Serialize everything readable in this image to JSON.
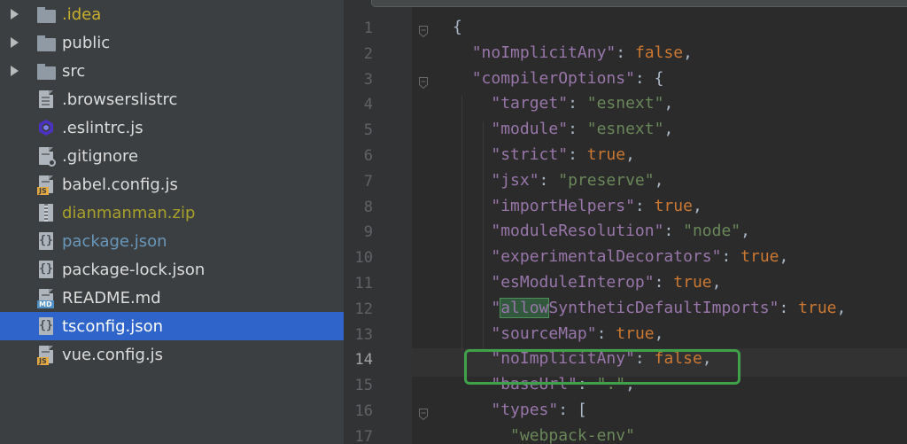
{
  "sidebar": {
    "items": [
      {
        "label": "idea",
        "prefix": ".",
        "icon": "folder-icon",
        "expandable": true,
        "color": "#c9b12d"
      },
      {
        "label": "public",
        "prefix": "",
        "icon": "folder-icon",
        "expandable": true,
        "color": "#dcdcdc"
      },
      {
        "label": "src",
        "prefix": "",
        "icon": "folder-icon",
        "expandable": true,
        "color": "#dcdcdc"
      },
      {
        "label": ".browserslistrc",
        "icon": "text-file-icon",
        "color": "#dcdcdc"
      },
      {
        "label": ".eslintrc.js",
        "icon": "eslint-icon",
        "color": "#dcdcdc"
      },
      {
        "label": ".gitignore",
        "icon": "gitignore-file-icon",
        "color": "#dcdcdc"
      },
      {
        "label": "babel.config.js",
        "icon": "js-file-icon",
        "color": "#dcdcdc"
      },
      {
        "label": "dianmanman.zip",
        "icon": "zip-file-icon",
        "color": "#a8a02a"
      },
      {
        "label": "package.json",
        "icon": "json-file-icon",
        "color": "#6897bb"
      },
      {
        "label": "package-lock.json",
        "icon": "json-file-icon",
        "color": "#dcdcdc"
      },
      {
        "label": "README.md",
        "icon": "md-file-icon",
        "color": "#dcdcdc"
      },
      {
        "label": "tsconfig.json",
        "icon": "json-file-icon",
        "color": "#ffffff",
        "selected": true
      },
      {
        "label": "vue.config.js",
        "icon": "js-file-icon",
        "color": "#dcdcdc"
      }
    ],
    "badges": {
      "js": "JS",
      "md": "MD"
    }
  },
  "editor": {
    "current_line": 14,
    "lines": [
      {
        "n": "1",
        "parts": [
          [
            "p",
            "{"
          ]
        ]
      },
      {
        "n": "2",
        "parts": [
          [
            "p",
            "  "
          ],
          [
            "k",
            "\"noImplicitAny\""
          ],
          [
            "p",
            ": "
          ],
          [
            "b",
            "false"
          ],
          [
            "p",
            ","
          ]
        ]
      },
      {
        "n": "3",
        "parts": [
          [
            "p",
            "  "
          ],
          [
            "k",
            "\"compilerOptions\""
          ],
          [
            "p",
            ": {"
          ]
        ]
      },
      {
        "n": "4",
        "parts": [
          [
            "p",
            "    "
          ],
          [
            "k",
            "\"target\""
          ],
          [
            "p",
            ": "
          ],
          [
            "s",
            "\"esnext\""
          ],
          [
            "p",
            ","
          ]
        ]
      },
      {
        "n": "5",
        "parts": [
          [
            "p",
            "    "
          ],
          [
            "k",
            "\"module\""
          ],
          [
            "p",
            ": "
          ],
          [
            "s",
            "\"esnext\""
          ],
          [
            "p",
            ","
          ]
        ]
      },
      {
        "n": "6",
        "parts": [
          [
            "p",
            "    "
          ],
          [
            "k",
            "\"strict\""
          ],
          [
            "p",
            ": "
          ],
          [
            "b",
            "true"
          ],
          [
            "p",
            ","
          ]
        ]
      },
      {
        "n": "7",
        "parts": [
          [
            "p",
            "    "
          ],
          [
            "k",
            "\"jsx\""
          ],
          [
            "p",
            ": "
          ],
          [
            "s",
            "\"preserve\""
          ],
          [
            "p",
            ","
          ]
        ]
      },
      {
        "n": "8",
        "parts": [
          [
            "p",
            "    "
          ],
          [
            "k",
            "\"importHelpers\""
          ],
          [
            "p",
            ": "
          ],
          [
            "b",
            "true"
          ],
          [
            "p",
            ","
          ]
        ]
      },
      {
        "n": "9",
        "parts": [
          [
            "p",
            "    "
          ],
          [
            "k",
            "\"moduleResolution\""
          ],
          [
            "p",
            ": "
          ],
          [
            "s",
            "\"node\""
          ],
          [
            "p",
            ","
          ]
        ]
      },
      {
        "n": "10",
        "parts": [
          [
            "p",
            "    "
          ],
          [
            "k",
            "\"experimentalDecorators\""
          ],
          [
            "p",
            ": "
          ],
          [
            "b",
            "true"
          ],
          [
            "p",
            ","
          ]
        ]
      },
      {
        "n": "11",
        "parts": [
          [
            "p",
            "    "
          ],
          [
            "k",
            "\"esModuleInterop\""
          ],
          [
            "p",
            ": "
          ],
          [
            "b",
            "true"
          ],
          [
            "p",
            ","
          ]
        ]
      },
      {
        "n": "12",
        "parts": [
          [
            "p",
            "    "
          ],
          [
            "k",
            "\""
          ],
          [
            "sel",
            "allow"
          ],
          [
            "k",
            "SyntheticDefaultImports\""
          ],
          [
            "p",
            ": "
          ],
          [
            "b",
            "true"
          ],
          [
            "p",
            ","
          ]
        ]
      },
      {
        "n": "13",
        "parts": [
          [
            "p",
            "    "
          ],
          [
            "k",
            "\"sourceMap\""
          ],
          [
            "p",
            ": "
          ],
          [
            "b",
            "true"
          ],
          [
            "p",
            ","
          ]
        ]
      },
      {
        "n": "14",
        "parts": [
          [
            "p",
            "    "
          ],
          [
            "k",
            "\"noImplicitAny\""
          ],
          [
            "p",
            ": "
          ],
          [
            "b",
            "false"
          ],
          [
            "p",
            ","
          ]
        ]
      },
      {
        "n": "15",
        "parts": [
          [
            "p",
            "    "
          ],
          [
            "k",
            "\"baseUrl\""
          ],
          [
            "p",
            ": "
          ],
          [
            "s",
            "\".\""
          ],
          [
            "p",
            ","
          ]
        ]
      },
      {
        "n": "16",
        "parts": [
          [
            "p",
            "    "
          ],
          [
            "k",
            "\"types\""
          ],
          [
            "p",
            ": ["
          ]
        ]
      },
      {
        "n": "17",
        "parts": [
          [
            "p",
            "      "
          ],
          [
            "s",
            "\"webpack-env\""
          ]
        ]
      }
    ],
    "fold_lines": [
      1,
      3,
      16
    ]
  },
  "colors": {
    "sidebar_bg": "#3c3f41",
    "selection": "#2f65ca",
    "editor_bg": "#2b2b2b",
    "key": "#9876aa",
    "string": "#6a8759",
    "keyword": "#cc7832",
    "annotation_box": "#3fa14a"
  }
}
